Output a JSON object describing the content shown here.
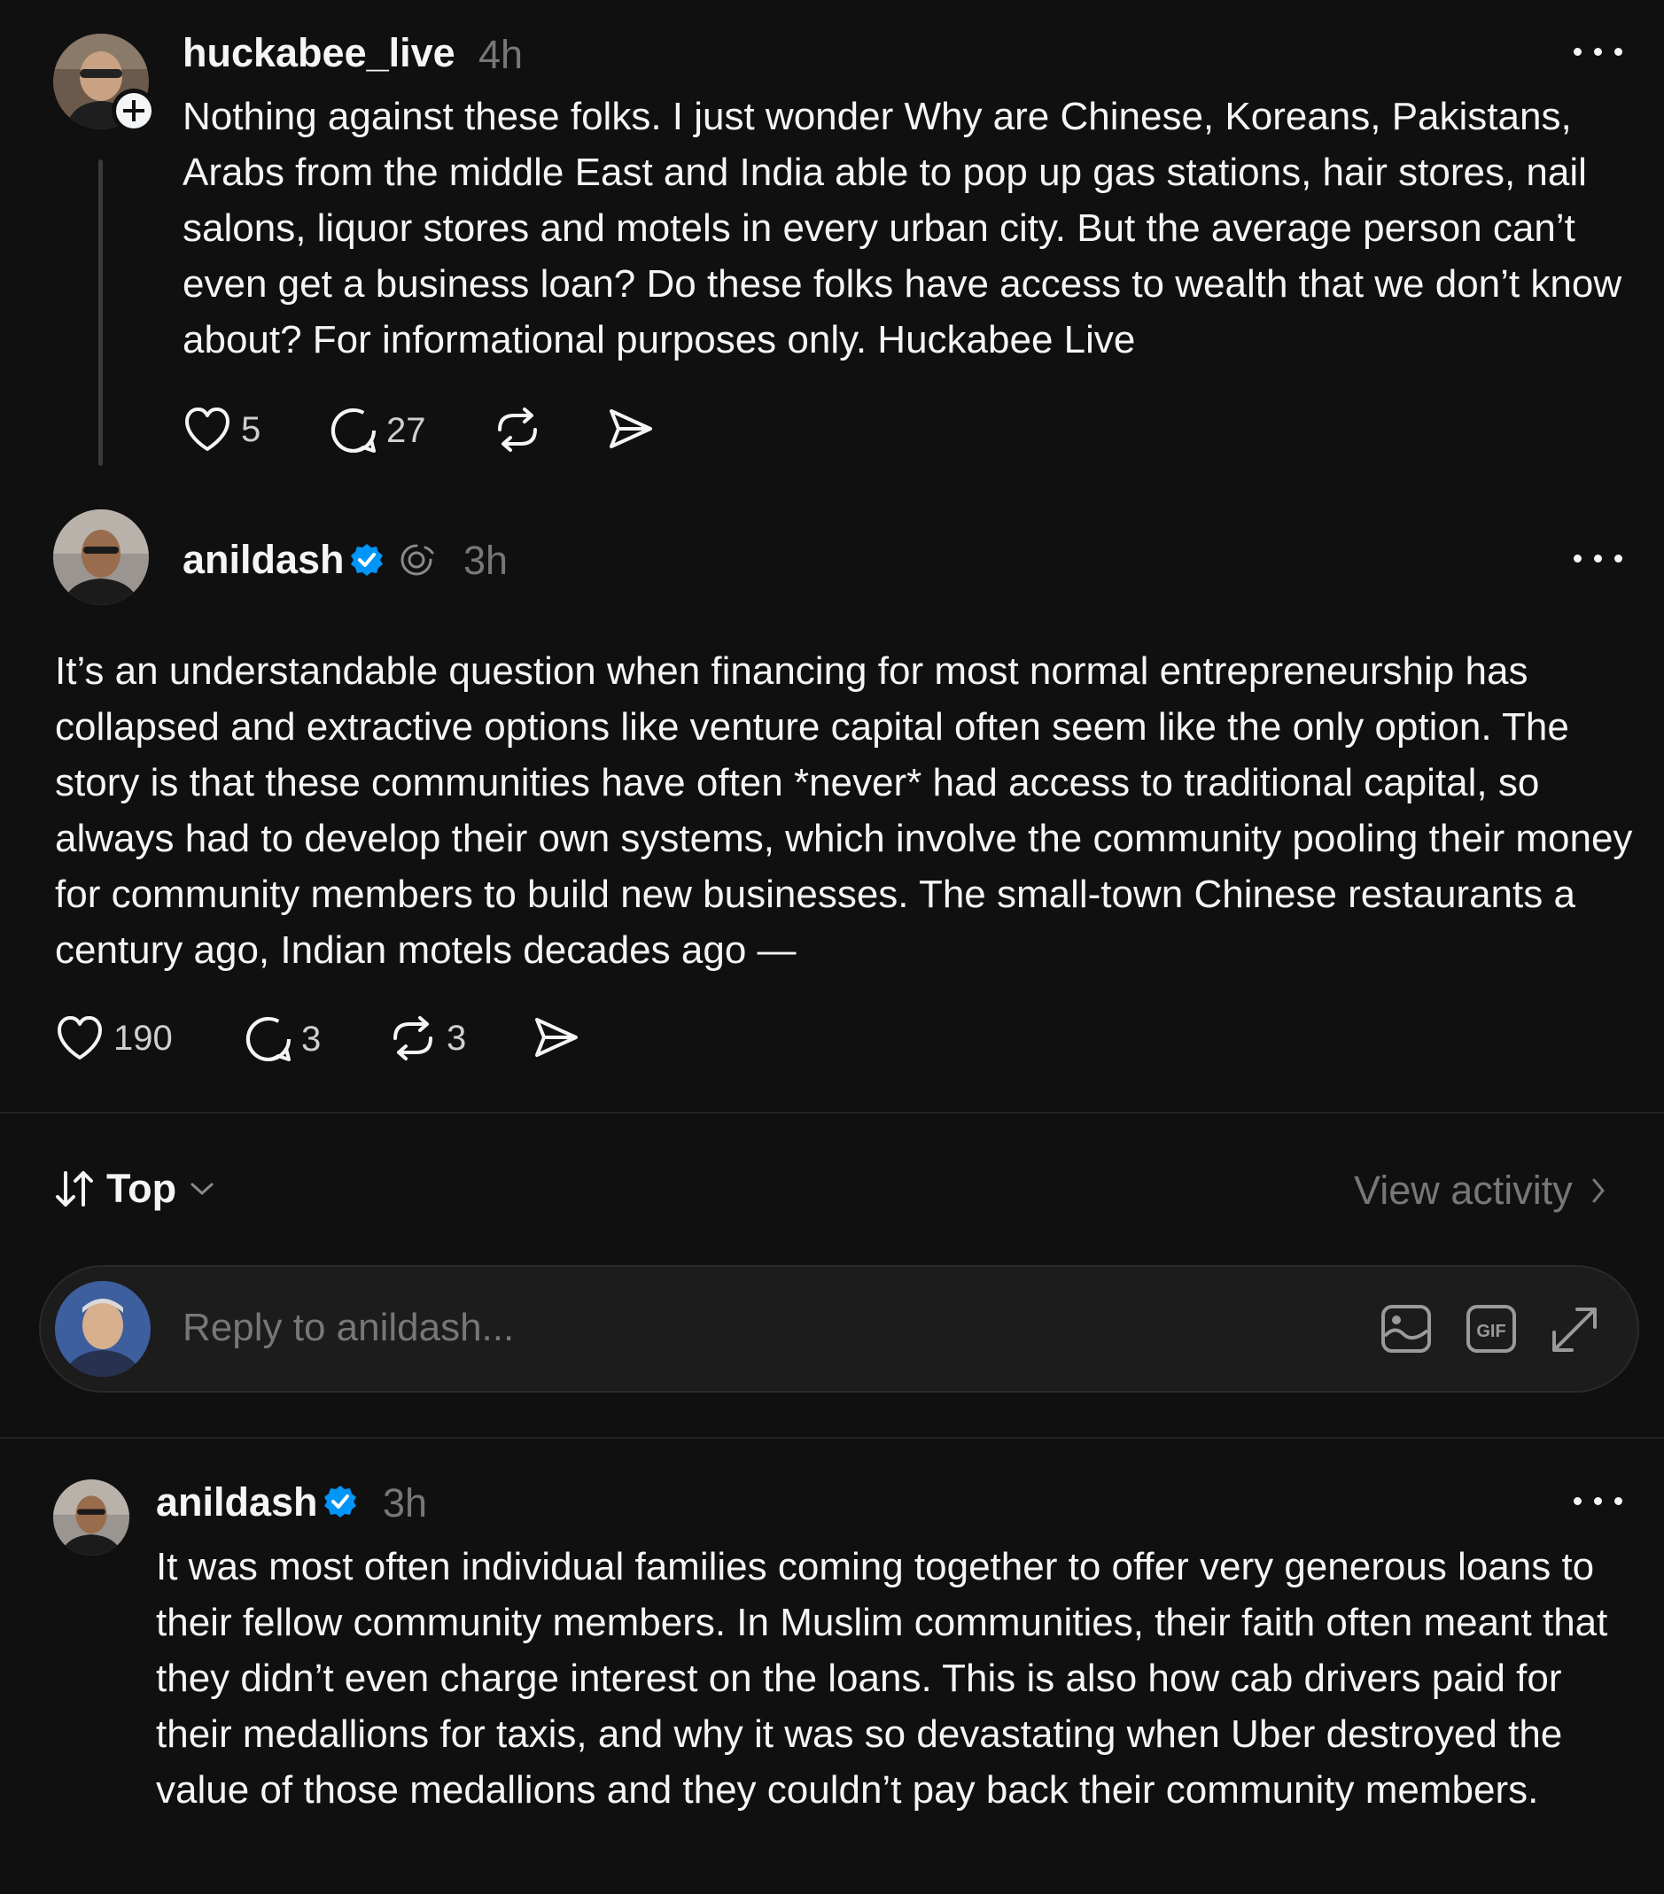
{
  "post1": {
    "username": "huckabee_live",
    "time": "4h",
    "text": "Nothing against these folks. I just wonder Why are Chinese, Koreans, Pakistans, Arabs from the middle East and India able to pop up gas stations, hair stores, nail salons, liquor stores and motels in every urban city. But the average person can’t even get a business loan? Do these folks have access to wealth that we don’t know about? For informational purposes only. Huckabee Live",
    "likes": "5",
    "replies": "27"
  },
  "post2": {
    "username": "anildash",
    "time": "3h",
    "text": "It’s an understandable question when financing for most normal entrepreneurship has collapsed and extractive options like venture capital often seem like the only option. The story is that these communities have often *never* had access to traditional capital, so always had to develop their own systems, which involve the community pooling their money for community members to build new businesses. The small-town Chinese restaurants a century ago, Indian motels decades ago —",
    "likes": "190",
    "replies": "3",
    "reposts": "3"
  },
  "sort": {
    "label": "Top",
    "view_activity": "View activity"
  },
  "composer": {
    "placeholder": "Reply to anildash..."
  },
  "reply1": {
    "username": "anildash",
    "time": "3h",
    "text": "It was most often individual families coming together to offer very generous loans to their fellow community members. In Muslim communities, their faith often meant that they didn’t even charge interest on the loans. This is also how cab drivers paid for their medallions for taxis, and why it was so devastating when Uber destroyed the value of those medallions and they couldn’t pay back their community members."
  },
  "icons": {
    "verified_color": "#0095f6",
    "more": "more-icon",
    "heart": "heart-icon",
    "comment": "comment-icon",
    "repost": "repost-icon",
    "share": "share-icon",
    "image": "image-icon",
    "gif": "gif-icon",
    "expand": "expand-icon",
    "fediverse": "fediverse-icon",
    "sort": "sort-icon"
  }
}
